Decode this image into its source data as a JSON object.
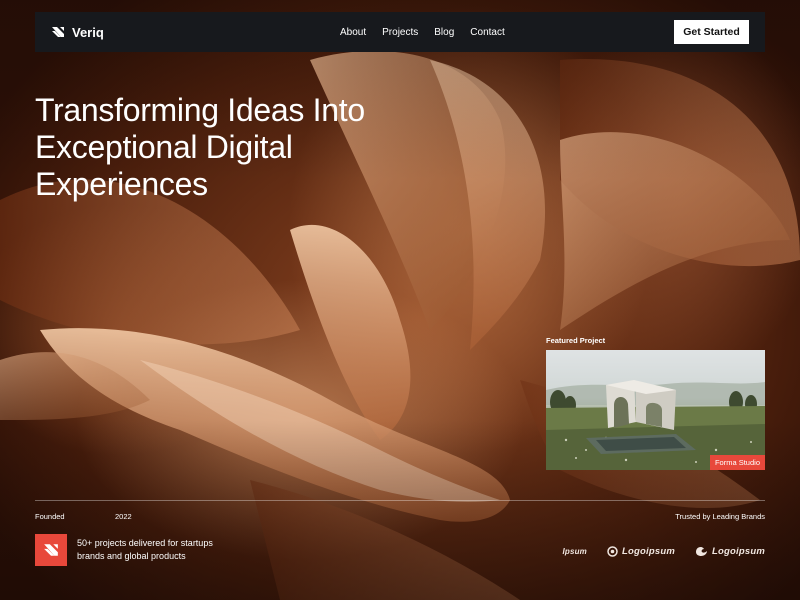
{
  "brand": {
    "name": "Veriq",
    "logo_icon": "veriq-logo-icon"
  },
  "nav": {
    "links": [
      "About",
      "Projects",
      "Blog",
      "Contact"
    ],
    "cta_label": "Get Started"
  },
  "hero": {
    "title_lines": [
      "Transforming Ideas Into",
      "Exceptional Digital",
      "Experiences"
    ]
  },
  "featured": {
    "label": "Featured Project",
    "tag": "Forma Studio"
  },
  "meta": {
    "founded_label": "Founded",
    "founded_year": "2022",
    "trusted_label": "Trusted by Leading Brands",
    "stat_lines": [
      "50+ projects delivered for startups",
      "brands and global products"
    ]
  },
  "partners": [
    "Ipsum",
    "Logoipsum",
    "Logoipsum"
  ],
  "colors": {
    "accent": "#e8483b",
    "nav_bg": "#17191d",
    "cta_bg": "#ffffff"
  }
}
